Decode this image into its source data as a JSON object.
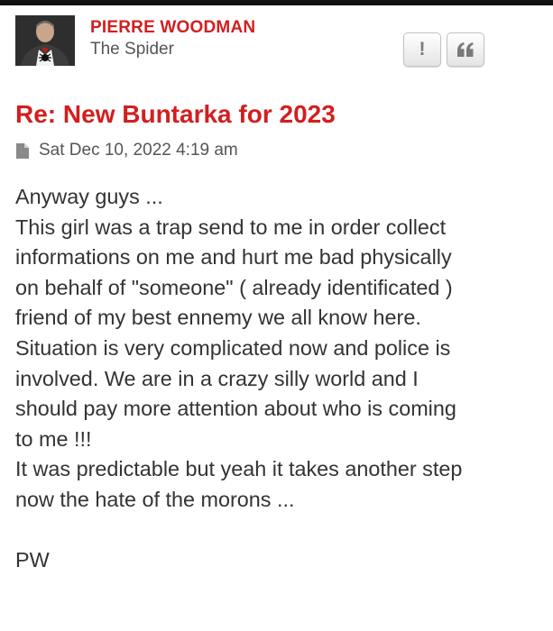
{
  "post": {
    "author": {
      "name": "PIERRE WOODMAN",
      "rank": "The Spider"
    },
    "buttons": {
      "report_label": "!",
      "quote_icon": "quote-icon"
    },
    "title": "Re: New Buntarka for 2023",
    "meta": {
      "icon": "file-icon",
      "date": "Sat Dec 10, 2022 4:19 am"
    },
    "body_lines": [
      "Anyway guys ...",
      "This girl was a trap send to me in order collect",
      "informations on me and hurt me bad physically",
      "on behalf of \"someone\" ( already identificated )",
      "friend of my best ennemy we all know here.",
      "Situation is very complicated now and police is",
      "involved. We are in a crazy silly world and I",
      "should pay more attention about who is coming",
      "to me !!!",
      "It was predictable but yeah it takes another step",
      "now the hate of the morons ..."
    ],
    "signature": "PW"
  },
  "colors": {
    "accent": "#d31e1e",
    "text": "#333333",
    "muted": "#555555"
  }
}
